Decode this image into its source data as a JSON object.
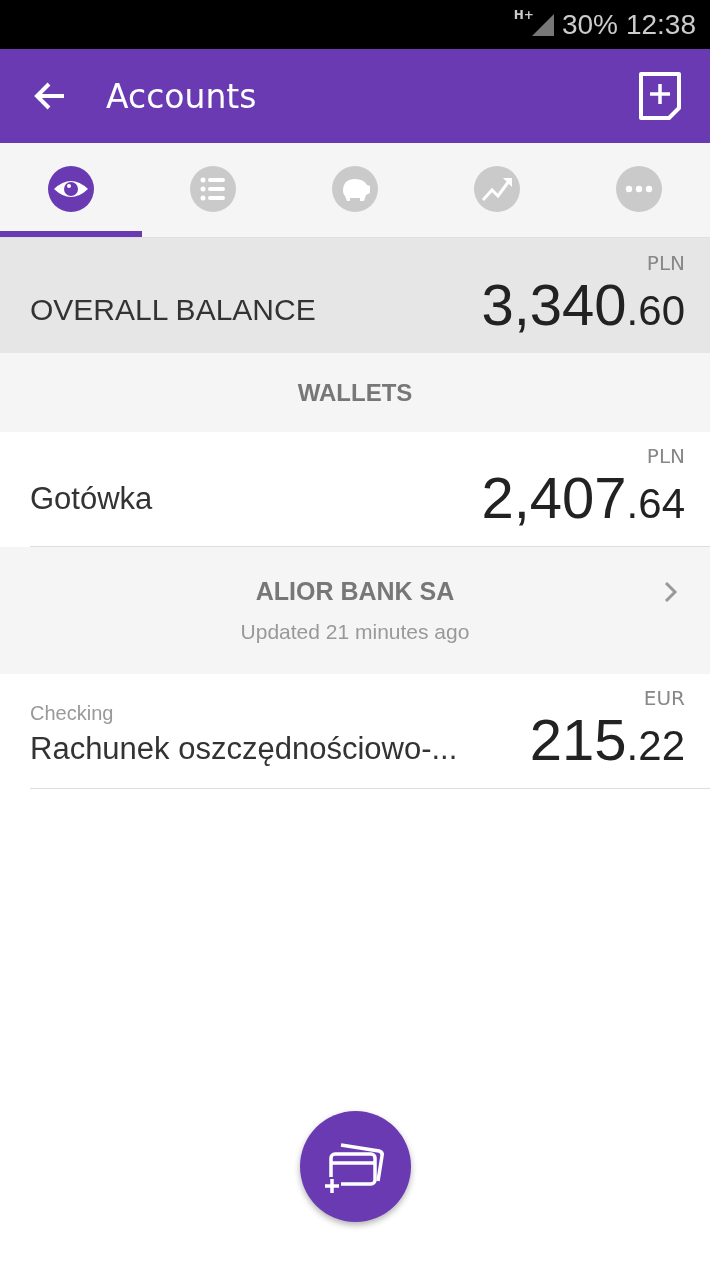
{
  "status_bar": {
    "network": "H+",
    "battery": "30%",
    "time": "12:38"
  },
  "app_bar": {
    "title": "Accounts"
  },
  "tabs": [
    {
      "selected": true
    },
    {
      "selected": false
    },
    {
      "selected": false
    },
    {
      "selected": false
    },
    {
      "selected": false
    }
  ],
  "overall_balance": {
    "label": "OVERALL BALANCE",
    "currency": "PLN",
    "amount": "3,340.60"
  },
  "sections": [
    {
      "kind": "header",
      "title": "WALLETS"
    },
    {
      "kind": "account",
      "name": "Gotówka",
      "currency": "PLN",
      "amount": "2,407.64"
    },
    {
      "kind": "bank",
      "title": "ALIOR BANK SA",
      "subtitle": "Updated 21 minutes ago"
    },
    {
      "kind": "account",
      "type": "Checking",
      "name": "Rachunek oszczędnościowo-...",
      "currency": "EUR",
      "amount": "215.22"
    }
  ]
}
